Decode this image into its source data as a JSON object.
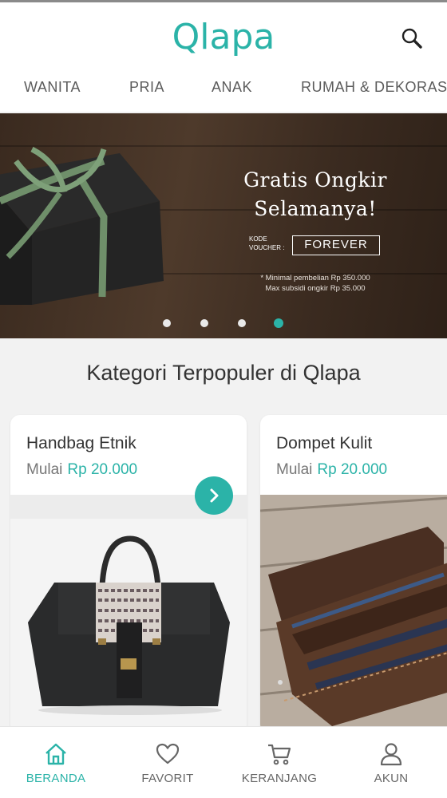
{
  "header": {
    "logo_text": "Qlapa",
    "search_icon": "search-icon"
  },
  "nav": {
    "items": [
      {
        "label": "WANITA"
      },
      {
        "label": "PRIA"
      },
      {
        "label": "ANAK"
      },
      {
        "label": "RUMAH & DEKORASI"
      }
    ]
  },
  "banner": {
    "title_line1": "Gratis Ongkir",
    "title_line2": "Selamanya!",
    "voucher_label_line1": "KODE",
    "voucher_label_line2": "VOUCHER :",
    "voucher_code": "FOREVER",
    "note_line1": "* Minimal pembelian Rp 350.000",
    "note_line2": "Max subsidi ongkir Rp 35.000",
    "slide_count": 4,
    "active_slide": 4,
    "colors": {
      "accent": "#2bb3a8",
      "wood": "#4e3a2b"
    }
  },
  "section": {
    "title": "Kategori Terpopuler di Qlapa"
  },
  "categories": [
    {
      "name": "Handbag Etnik",
      "price_prefix": "Mulai",
      "price": "Rp 20.000",
      "image": "handbag-photo"
    },
    {
      "name": "Dompet Kulit",
      "price_prefix": "Mulai",
      "price": "Rp 20.000",
      "image": "leather-wallet-photo"
    }
  ],
  "bottom_nav": {
    "tabs": [
      {
        "label": "BERANDA",
        "icon": "home-icon",
        "active": true
      },
      {
        "label": "FAVORIT",
        "icon": "heart-icon",
        "active": false
      },
      {
        "label": "KERANJANG",
        "icon": "cart-icon",
        "active": false
      },
      {
        "label": "AKUN",
        "icon": "user-icon",
        "active": false
      }
    ]
  },
  "colors": {
    "accent": "#2bb3a8",
    "text": "#333333",
    "muted": "#777777"
  }
}
